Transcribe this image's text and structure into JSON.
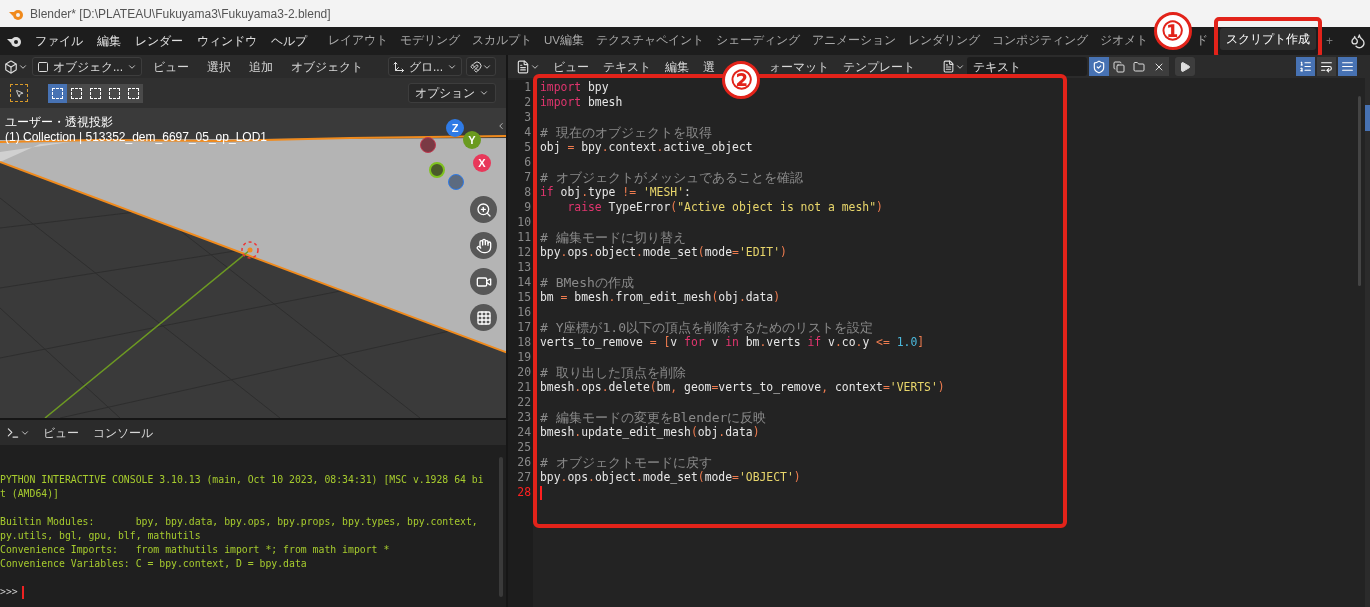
{
  "window": {
    "title": "Blender* [D:\\PLATEAU\\Fukuyama3\\Fukuyama3-2.blend]"
  },
  "menu": [
    "ファイル",
    "編集",
    "レンダー",
    "ウィンドウ",
    "ヘルプ"
  ],
  "workspace_tabs": [
    {
      "label": "レイアウト",
      "selected": false
    },
    {
      "label": "モデリング",
      "selected": false
    },
    {
      "label": "スカルプト",
      "selected": false
    },
    {
      "label": "UV編集",
      "selected": false
    },
    {
      "label": "テクスチャペイント",
      "selected": false
    },
    {
      "label": "シェーディング",
      "selected": false
    },
    {
      "label": "アニメーション",
      "selected": false
    },
    {
      "label": "レンダリング",
      "selected": false
    },
    {
      "label": "コンポジティング",
      "selected": false
    },
    {
      "label": "ジオメト",
      "selected": false
    },
    {
      "label": "ド",
      "selected": false
    },
    {
      "label": "スクリプト作成",
      "selected": true
    }
  ],
  "add_tab": "+",
  "annotations": [
    "①",
    "②"
  ],
  "viewport": {
    "mode": "オブジェク...",
    "menu": [
      "ビュー",
      "選択",
      "追加",
      "オブジェクト"
    ],
    "orientation": "グロ...",
    "select_modes": [
      {
        "selected": true
      },
      {
        "selected": false
      },
      {
        "selected": false
      },
      {
        "selected": false
      },
      {
        "selected": false
      }
    ],
    "options": "オプション",
    "view_name": "ユーザー・透視投影",
    "collection": "(1) Collection | 513352_dem_6697_05_op_LOD1",
    "axes": [
      {
        "label": "Z",
        "color": "#2f7be6"
      },
      {
        "label": "Y",
        "color": "#6a9a1f"
      },
      {
        "label": "X",
        "color": "#e8385a"
      }
    ]
  },
  "console": {
    "menu": [
      "ビュー",
      "コンソール"
    ],
    "blocks": [
      [
        "PYTHON INTERACTIVE CONSOLE 3.10.13 (main, Oct 10 2023, 08:34:31) [MSC v.1928 64 bi",
        "t (AMD64)]"
      ],
      [
        "Builtin Modules:       bpy, bpy.data, bpy.ops, bpy.props, bpy.types, bpy.context,",
        "py.utils, bgl, gpu, blf, mathutils",
        "Convenience Imports:   from mathutils import *; from math import *",
        "Convenience Variables: C = bpy.context, D = bpy.data"
      ]
    ],
    "prompt": ">>>"
  },
  "editor": {
    "menu_before": [
      "ビュー",
      "テキスト",
      "編集",
      "選"
    ],
    "menu_after": [
      "ォーマット",
      "テンプレート"
    ],
    "text_name": "テキスト",
    "toggles": [
      {
        "kind": "line-numbers",
        "on": true
      },
      {
        "kind": "word-wrap",
        "on": false
      },
      {
        "kind": "syntax",
        "on": true
      }
    ],
    "lines": [
      {
        "n": "1",
        "current": false,
        "tokens": [
          {
            "kind": "kw",
            "text": "import"
          },
          {
            "kind": "p",
            "text": " bpy"
          }
        ]
      },
      {
        "n": "2",
        "current": false,
        "tokens": [
          {
            "kind": "kw",
            "text": "import"
          },
          {
            "kind": "p",
            "text": " bmesh"
          }
        ]
      },
      {
        "n": "3",
        "current": false
      },
      {
        "n": "4",
        "current": false,
        "tokens": [
          {
            "kind": "c",
            "text": "# 現在のオブジェクトを取得"
          }
        ]
      },
      {
        "n": "5",
        "current": false,
        "tokens": [
          {
            "kind": "p",
            "text": "obj "
          },
          {
            "kind": "o",
            "text": "="
          },
          {
            "kind": "p",
            "text": " bpy"
          },
          {
            "kind": "o",
            "text": "."
          },
          {
            "kind": "p",
            "text": "context"
          },
          {
            "kind": "o",
            "text": "."
          },
          {
            "kind": "p",
            "text": "active_object"
          }
        ]
      },
      {
        "n": "6",
        "current": false
      },
      {
        "n": "7",
        "current": false,
        "tokens": [
          {
            "kind": "c",
            "text": "# オブジェクトがメッシュであることを確認"
          }
        ]
      },
      {
        "n": "8",
        "current": false,
        "tokens": [
          {
            "kind": "kw",
            "text": "if"
          },
          {
            "kind": "p",
            "text": " obj"
          },
          {
            "kind": "o",
            "text": "."
          },
          {
            "kind": "p",
            "text": "type "
          },
          {
            "kind": "o",
            "text": "!="
          },
          {
            "kind": "s",
            "text": " 'MESH'"
          },
          {
            "kind": "p",
            "text": ":"
          }
        ]
      },
      {
        "n": "9",
        "current": false,
        "tokens": [
          {
            "kind": "kw",
            "text": "    raise"
          },
          {
            "kind": "p",
            "text": " TypeError"
          },
          {
            "kind": "o",
            "text": "("
          },
          {
            "kind": "s",
            "text": "\"Active object is not a mesh\""
          },
          {
            "kind": "o",
            "text": ")"
          }
        ]
      },
      {
        "n": "10",
        "current": false
      },
      {
        "n": "11",
        "current": false,
        "tokens": [
          {
            "kind": "c",
            "text": "# 編集モードに切り替え"
          }
        ]
      },
      {
        "n": "12",
        "current": false,
        "tokens": [
          {
            "kind": "p",
            "text": "bpy"
          },
          {
            "kind": "o",
            "text": "."
          },
          {
            "kind": "p",
            "text": "ops"
          },
          {
            "kind": "o",
            "text": "."
          },
          {
            "kind": "p",
            "text": "object"
          },
          {
            "kind": "o",
            "text": "."
          },
          {
            "kind": "p",
            "text": "mode_set"
          },
          {
            "kind": "o",
            "text": "("
          },
          {
            "kind": "p",
            "text": "mode"
          },
          {
            "kind": "o",
            "text": "="
          },
          {
            "kind": "s",
            "text": "'EDIT'"
          },
          {
            "kind": "o",
            "text": ")"
          }
        ]
      },
      {
        "n": "13",
        "current": false
      },
      {
        "n": "14",
        "current": false,
        "tokens": [
          {
            "kind": "c",
            "text": "# BMeshの作成"
          }
        ]
      },
      {
        "n": "15",
        "current": false,
        "tokens": [
          {
            "kind": "p",
            "text": "bm "
          },
          {
            "kind": "o",
            "text": "="
          },
          {
            "kind": "p",
            "text": " bmesh"
          },
          {
            "kind": "o",
            "text": "."
          },
          {
            "kind": "p",
            "text": "from_edit_mesh"
          },
          {
            "kind": "o",
            "text": "("
          },
          {
            "kind": "p",
            "text": "obj"
          },
          {
            "kind": "o",
            "text": "."
          },
          {
            "kind": "p",
            "text": "data"
          },
          {
            "kind": "o",
            "text": ")"
          }
        ]
      },
      {
        "n": "16",
        "current": false
      },
      {
        "n": "17",
        "current": false,
        "tokens": [
          {
            "kind": "c",
            "text": "# Y座標が1.0以下の頂点を削除するためのリストを設定"
          }
        ]
      },
      {
        "n": "18",
        "current": false,
        "tokens": [
          {
            "kind": "p",
            "text": "verts_to_remove "
          },
          {
            "kind": "o",
            "text": "= ["
          },
          {
            "kind": "p",
            "text": "v "
          },
          {
            "kind": "kw",
            "text": "for"
          },
          {
            "kind": "p",
            "text": " v "
          },
          {
            "kind": "kw",
            "text": "in"
          },
          {
            "kind": "p",
            "text": " bm"
          },
          {
            "kind": "o",
            "text": "."
          },
          {
            "kind": "p",
            "text": "verts "
          },
          {
            "kind": "kw",
            "text": "if"
          },
          {
            "kind": "p",
            "text": " v"
          },
          {
            "kind": "o",
            "text": "."
          },
          {
            "kind": "p",
            "text": "co"
          },
          {
            "kind": "o",
            "text": "."
          },
          {
            "kind": "p",
            "text": "y "
          },
          {
            "kind": "o",
            "text": "<="
          },
          {
            "kind": "n",
            "text": " 1.0"
          },
          {
            "kind": "o",
            "text": "]"
          }
        ]
      },
      {
        "n": "19",
        "current": false
      },
      {
        "n": "20",
        "current": false,
        "tokens": [
          {
            "kind": "c",
            "text": "# 取り出した頂点を削除"
          }
        ]
      },
      {
        "n": "21",
        "current": false,
        "tokens": [
          {
            "kind": "p",
            "text": "bmesh"
          },
          {
            "kind": "o",
            "text": "."
          },
          {
            "kind": "p",
            "text": "ops"
          },
          {
            "kind": "o",
            "text": "."
          },
          {
            "kind": "p",
            "text": "delete"
          },
          {
            "kind": "o",
            "text": "("
          },
          {
            "kind": "p",
            "text": "bm"
          },
          {
            "kind": "o",
            "text": ","
          },
          {
            "kind": "p",
            "text": " geom"
          },
          {
            "kind": "o",
            "text": "="
          },
          {
            "kind": "p",
            "text": "verts_to_remove"
          },
          {
            "kind": "o",
            "text": ","
          },
          {
            "kind": "p",
            "text": " context"
          },
          {
            "kind": "o",
            "text": "="
          },
          {
            "kind": "s",
            "text": "'VERTS'"
          },
          {
            "kind": "o",
            "text": ")"
          }
        ]
      },
      {
        "n": "22",
        "current": false
      },
      {
        "n": "23",
        "current": false,
        "tokens": [
          {
            "kind": "c",
            "text": "# 編集モードの変更をBlenderに反映"
          }
        ]
      },
      {
        "n": "24",
        "current": false,
        "tokens": [
          {
            "kind": "p",
            "text": "bmesh"
          },
          {
            "kind": "o",
            "text": "."
          },
          {
            "kind": "p",
            "text": "update_edit_mesh"
          },
          {
            "kind": "o",
            "text": "("
          },
          {
            "kind": "p",
            "text": "obj"
          },
          {
            "kind": "o",
            "text": "."
          },
          {
            "kind": "p",
            "text": "data"
          },
          {
            "kind": "o",
            "text": ")"
          }
        ]
      },
      {
        "n": "25",
        "current": false
      },
      {
        "n": "26",
        "current": false,
        "tokens": [
          {
            "kind": "c",
            "text": "# オブジェクトモードに戻す"
          }
        ]
      },
      {
        "n": "27",
        "current": false,
        "tokens": [
          {
            "kind": "p",
            "text": "bpy"
          },
          {
            "kind": "o",
            "text": "."
          },
          {
            "kind": "p",
            "text": "ops"
          },
          {
            "kind": "o",
            "text": "."
          },
          {
            "kind": "p",
            "text": "object"
          },
          {
            "kind": "o",
            "text": "."
          },
          {
            "kind": "p",
            "text": "mode_set"
          },
          {
            "kind": "o",
            "text": "("
          },
          {
            "kind": "p",
            "text": "mode"
          },
          {
            "kind": "o",
            "text": "="
          },
          {
            "kind": "s",
            "text": "'OBJECT'"
          },
          {
            "kind": "o",
            "text": ")"
          }
        ]
      },
      {
        "n": "28",
        "current": true
      }
    ]
  }
}
